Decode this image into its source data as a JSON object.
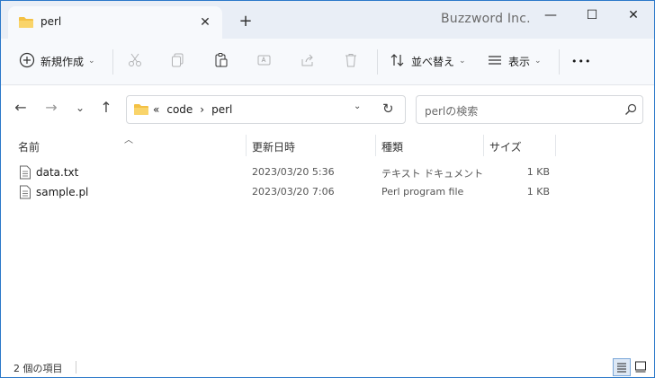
{
  "window": {
    "tab_title": "perl",
    "brand": "Buzzword Inc.",
    "controls": [
      "minimize",
      "maximize",
      "close"
    ]
  },
  "toolbar": {
    "new_label": "新規作成",
    "sort_label": "並べ替え",
    "view_label": "表示",
    "more_label": "•••",
    "icons": [
      "plus-circle-icon",
      "cut-icon",
      "copy-icon",
      "paste-icon",
      "rename-icon",
      "share-icon",
      "delete-icon",
      "sort-icon",
      "view-icon",
      "more-icon"
    ]
  },
  "address": {
    "overflow": "«",
    "crumbs": [
      "code",
      "perl"
    ],
    "separator": "›"
  },
  "search": {
    "placeholder": "perlの検索"
  },
  "columns": {
    "name": "名前",
    "modified": "更新日時",
    "type": "種類",
    "size": "サイズ"
  },
  "files": [
    {
      "name": "data.txt",
      "modified": "2023/03/20 5:36",
      "type": "テキスト ドキュメント",
      "size": "1 KB"
    },
    {
      "name": "sample.pl",
      "modified": "2023/03/20 7:06",
      "type": "Perl program file",
      "size": "1 KB"
    }
  ],
  "status": {
    "count_text": "2 個の項目"
  },
  "colors": {
    "border": "#2b78c9",
    "titlebar": "#e9eef6",
    "folder": "#f4c144"
  }
}
